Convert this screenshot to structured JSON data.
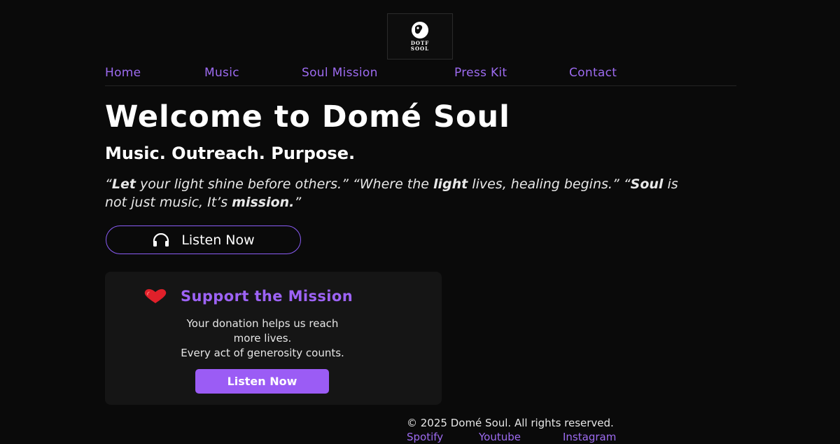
{
  "logo": {
    "text_line1": "DOTF",
    "text_line2": "SOOL"
  },
  "nav": {
    "items": [
      {
        "label": "Home"
      },
      {
        "label": "Music"
      },
      {
        "label": "Soul Mission"
      },
      {
        "label": "Press Kit"
      },
      {
        "label": "Contact"
      }
    ]
  },
  "hero": {
    "title": "Welcome to Domé Soul",
    "subtitle": "Music. Outreach. Purpose.",
    "quote1_open": "“",
    "quote1_bold": "Let",
    "quote1_rest": " your light shine before others.”  “Where the ",
    "quote2_bold": "light",
    "quote2_rest": " lives, healing begins.”  “",
    "quote3_bold1": "Soul",
    "quote3_rest": " is not just music, It’s ",
    "quote3_bold2": "mission.",
    "quote3_close": "”",
    "listen_button": "Listen Now",
    "listen_icon": "headphones-icon"
  },
  "support": {
    "icon": "heart-icon",
    "title": "Support the Mission",
    "line1": "Your donation helps us reach",
    "line2": "more lives.",
    "line3": "Every act of generosity counts.",
    "button": "Listen Now"
  },
  "footer": {
    "copyright": "© 2025 Domé Soul. All rights reserved.",
    "links": [
      {
        "label": "Spotify"
      },
      {
        "label": "Youtube"
      },
      {
        "label": "Instagram"
      }
    ]
  },
  "colors": {
    "background": "#0a0a0a",
    "accent": "#9b5cf5",
    "heart": "#e0202a",
    "card": "#151515"
  }
}
